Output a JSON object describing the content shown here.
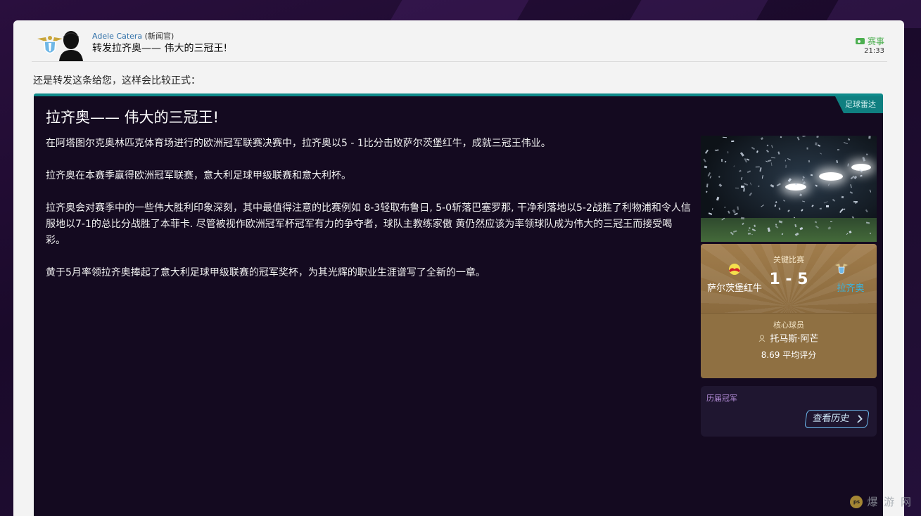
{
  "message": {
    "sender_name": "Adele Catera",
    "sender_role": "(新闻官)",
    "subject": "转发拉齐奥—— 伟大的三冠王!",
    "category": "赛事",
    "time": "21:33",
    "intro": "还是转发这条给您，这样会比较正式："
  },
  "article": {
    "source": "足球雷达",
    "headline": "拉齐奥—— 伟大的三冠王!",
    "paragraphs": [
      [
        "在阿塔图尔克奥林匹克体育场进行的欧洲冠军联赛决赛中，拉齐奥以5 - 1比分击败萨尔茨堡红牛，成就三冠王伟业。"
      ],
      [
        "拉齐奥在本赛季赢得欧洲冠军联赛，意大利足球甲级联赛和意大利杯。"
      ],
      [
        "拉齐奥会对赛季中的一些伟大胜利印象深刻，其中最值得注意的比赛例如 8-3轻取布鲁日, 5-0斩落巴塞罗那, 干净利落地以5-2战胜了利物浦和令人信服地以7-1的总比分战胜了本菲卡. 尽管被视作欧洲冠军杯冠军有力的争夺者，球队主教练家傲 黄仍然应该为率领球队成为伟大的三冠王而接受喝彩。"
      ],
      [
        "黄于5月率领拉齐奥捧起了意大利足球甲级联赛的冠军奖杯，为其光辉的职业生涯谱写了全新的一章。"
      ]
    ]
  },
  "key_match": {
    "label": "关键比赛",
    "home_team": "萨尔茨堡红牛",
    "away_team": "拉齐奥",
    "score": "1 - 5",
    "home_crest_icon": "red-bull-crest-icon",
    "away_crest_icon": "lazio-eagle-crest-icon"
  },
  "key_player": {
    "label": "核心球员",
    "name": "托马斯·阿芒",
    "rating": "8.69 平均评分"
  },
  "history": {
    "title": "历届冠军",
    "button": "查看历史"
  },
  "colors": {
    "accent_teal": "#0f8a8a",
    "tag_green": "#4caf50",
    "card_gold": "#a07c4b",
    "article_bg": "#140a20"
  }
}
